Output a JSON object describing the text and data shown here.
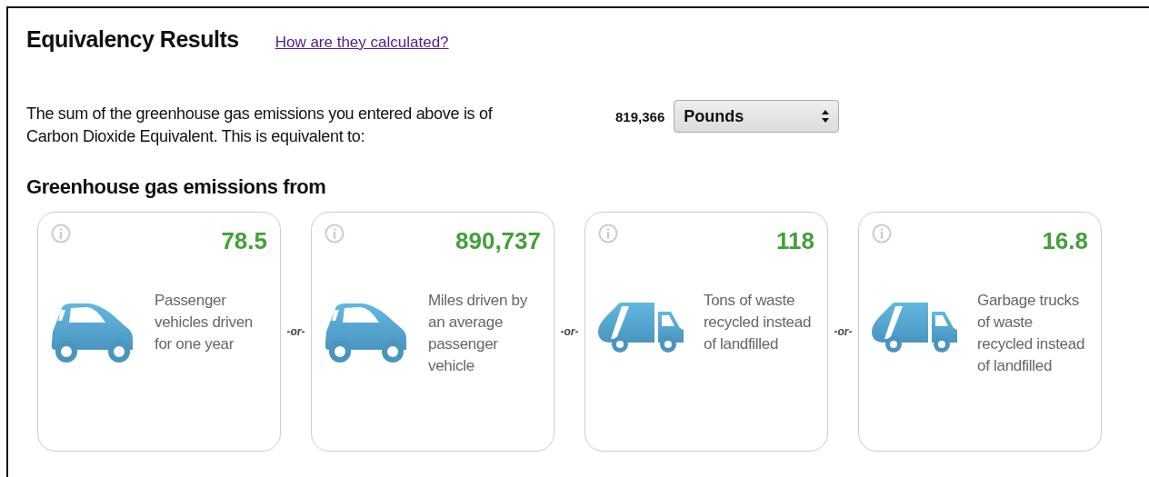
{
  "title": "Equivalency Results",
  "link": "How are they calculated?",
  "summary": "The sum of the greenhouse gas emissions you entered above is of Carbon Dioxide Equivalent. This is equivalent to:",
  "total": "819,366",
  "unit_select": {
    "value": "Pounds"
  },
  "section_title": "Greenhouse gas emissions from",
  "separators": [
    "-or-",
    "-or-",
    "-or-"
  ],
  "cards": [
    {
      "kind": "car",
      "value": "78.5",
      "text": "Passenger vehicles driven for one year"
    },
    {
      "kind": "car",
      "value": "890,737",
      "text": "Miles driven by an average passenger vehicle"
    },
    {
      "kind": "truck",
      "value": "118",
      "text": "Tons of waste recycled instead of landfilled"
    },
    {
      "kind": "truck",
      "value": "16.8",
      "text": "Garbage trucks of waste recycled instead of landfilled"
    }
  ]
}
